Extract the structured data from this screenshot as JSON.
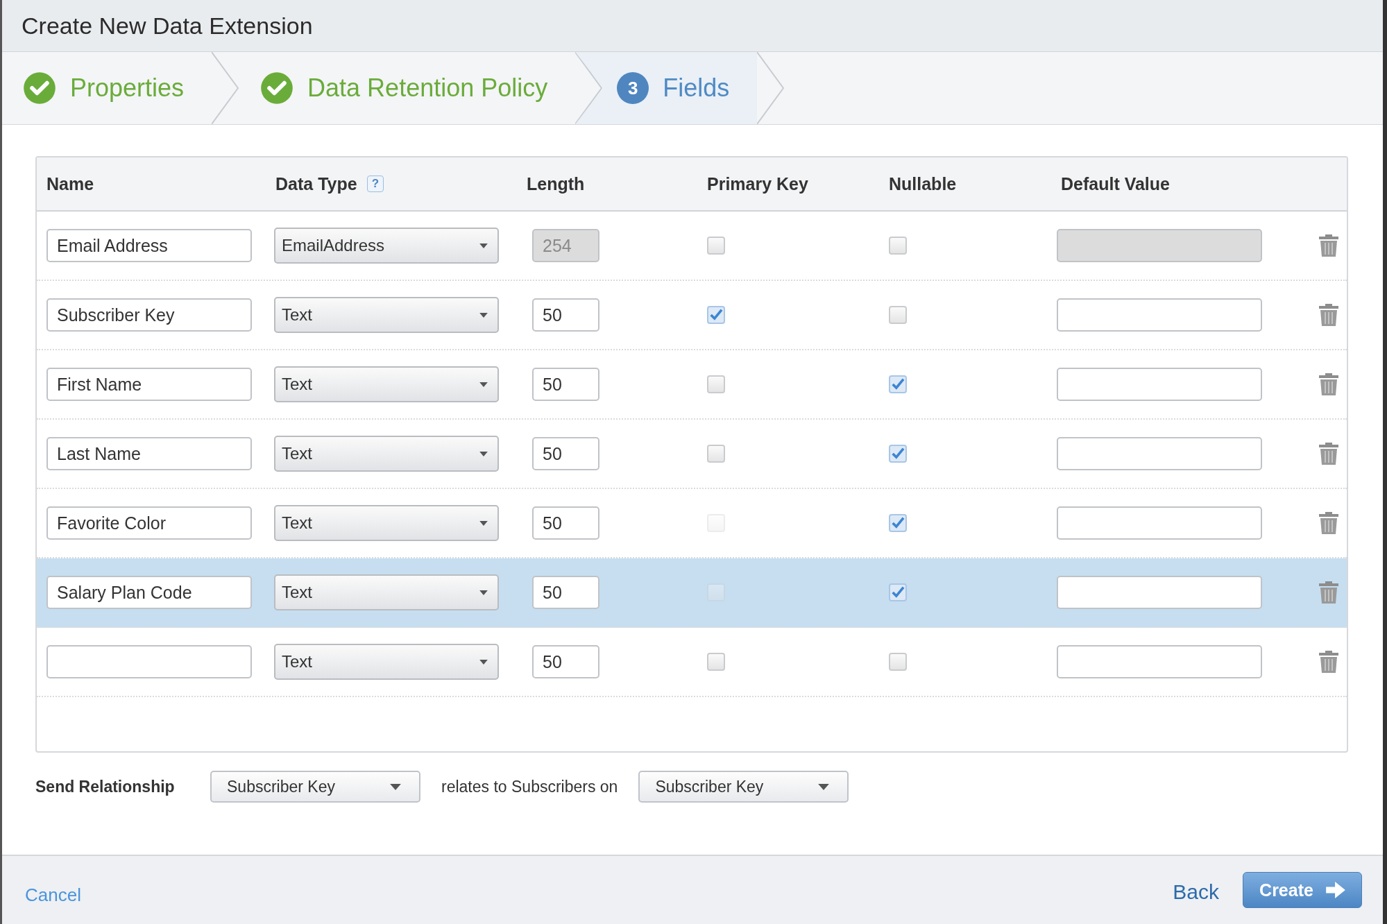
{
  "window": {
    "title": "Create New Data Extension"
  },
  "steps": [
    {
      "label": "Properties",
      "kind": "done"
    },
    {
      "label": "Data Retention Policy",
      "kind": "done"
    },
    {
      "label": "Fields",
      "kind": "current",
      "number": "3"
    }
  ],
  "table": {
    "help_icon": "?",
    "columns": [
      "Name",
      "Data Type",
      "Length",
      "Primary Key",
      "Nullable",
      "Default Value"
    ],
    "rows": [
      {
        "name": "Email Address",
        "data_type": "EmailAddress",
        "length": "254",
        "length_disabled": true,
        "primary_key": false,
        "primary_key_disabled": false,
        "nullable": false,
        "default_disabled": true,
        "selected": false
      },
      {
        "name": "Subscriber Key",
        "data_type": "Text",
        "length": "50",
        "length_disabled": false,
        "primary_key": true,
        "primary_key_disabled": false,
        "nullable": false,
        "default_disabled": false,
        "selected": false
      },
      {
        "name": "First Name",
        "data_type": "Text",
        "length": "50",
        "length_disabled": false,
        "primary_key": false,
        "primary_key_disabled": false,
        "nullable": true,
        "default_disabled": false,
        "selected": false
      },
      {
        "name": "Last Name",
        "data_type": "Text",
        "length": "50",
        "length_disabled": false,
        "primary_key": false,
        "primary_key_disabled": false,
        "nullable": true,
        "default_disabled": false,
        "selected": false
      },
      {
        "name": "Favorite Color",
        "data_type": "Text",
        "length": "50",
        "length_disabled": false,
        "primary_key": false,
        "primary_key_disabled": true,
        "nullable": true,
        "default_disabled": false,
        "selected": false
      },
      {
        "name": "Salary Plan Code",
        "data_type": "Text",
        "length": "50",
        "length_disabled": false,
        "primary_key": false,
        "primary_key_disabled": true,
        "nullable": true,
        "default_disabled": false,
        "selected": true
      },
      {
        "data_type": "Text",
        "length": "50",
        "length_disabled": false,
        "primary_key": false,
        "primary_key_disabled": false,
        "nullable": false,
        "default_disabled": false,
        "selected": false
      }
    ]
  },
  "send_relationship": {
    "label": "Send Relationship",
    "value": "Subscriber Key",
    "relates_text": "relates to Subscribers on",
    "subscribers_value": "Subscriber Key"
  },
  "footer": {
    "cancel": "Cancel",
    "back": "Back",
    "create": "Create"
  }
}
